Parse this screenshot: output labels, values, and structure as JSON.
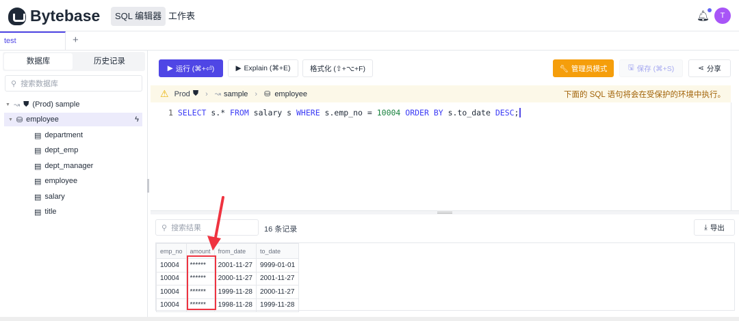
{
  "header": {
    "brand": "Bytebase",
    "nav": [
      "SQL 编辑器",
      "工作表"
    ],
    "avatar": "T"
  },
  "tabs": {
    "active": "test",
    "add": "+"
  },
  "sidebar": {
    "tabs": [
      "数据库",
      "历史记录"
    ],
    "search_placeholder": "搜索数据库",
    "instance": "(Prod) sample",
    "database": "employee",
    "tables": [
      "department",
      "dept_emp",
      "dept_manager",
      "employee",
      "salary",
      "title"
    ]
  },
  "toolbar": {
    "run": "运行 (⌘+⏎)",
    "explain": "Explain (⌘+E)",
    "format": "格式化 (⇧+⌥+F)",
    "admin": "管理员模式",
    "save": "保存 (⌘+S)",
    "share": "分享"
  },
  "breadcrumb": {
    "env": "Prod",
    "instance": "sample",
    "database": "employee",
    "warning": "下面的 SQL 语句将会在受保护的环境中执行。"
  },
  "editor": {
    "line": "1",
    "tokens": [
      [
        "SELECT",
        "kw"
      ],
      [
        " s.* ",
        ""
      ],
      [
        "FROM",
        "kw"
      ],
      [
        " salary s ",
        ""
      ],
      [
        "WHERE",
        "kw"
      ],
      [
        " s.emp_no = ",
        ""
      ],
      [
        "10004",
        "num"
      ],
      [
        " ",
        ""
      ],
      [
        "ORDER BY",
        "kw"
      ],
      [
        " s.to_date ",
        ""
      ],
      [
        "DESC",
        "kw"
      ],
      [
        ";",
        ""
      ]
    ]
  },
  "results": {
    "search_placeholder": "搜索结果",
    "count": "16 条记录",
    "export": "导出",
    "columns": [
      "emp_no",
      "amount",
      "from_date",
      "to_date"
    ],
    "rows": [
      [
        "10004",
        "******",
        "2001-11-27",
        "9999-01-01"
      ],
      [
        "10004",
        "******",
        "2000-11-27",
        "2001-11-27"
      ],
      [
        "10004",
        "******",
        "1999-11-28",
        "2000-11-27"
      ],
      [
        "10004",
        "******",
        "1998-11-28",
        "1999-11-28"
      ]
    ]
  },
  "colors": {
    "primary": "#4f46e5",
    "admin": "#f59e0b",
    "highlight": "#ef3340"
  }
}
